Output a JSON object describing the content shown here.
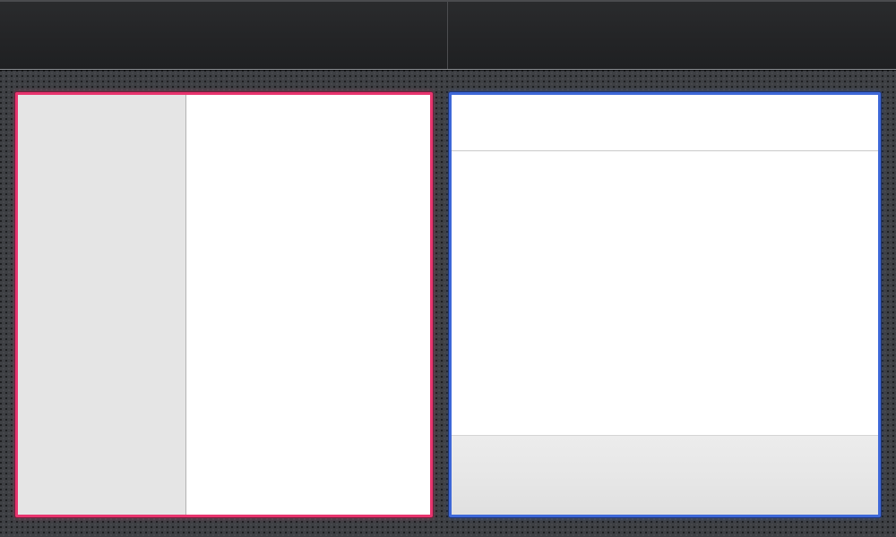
{
  "toolbar": {
    "left_title": "",
    "right_title": ""
  },
  "colors": {
    "left_panel_accent": "#e8346e",
    "right_panel_accent": "#3e68d8",
    "background": "#3e4044",
    "toolbar": "#252628"
  },
  "left_panel": {
    "sidebar_text": "",
    "detail_text": ""
  },
  "right_panel": {
    "header_text": "",
    "content_text": "",
    "footer_text": ""
  }
}
